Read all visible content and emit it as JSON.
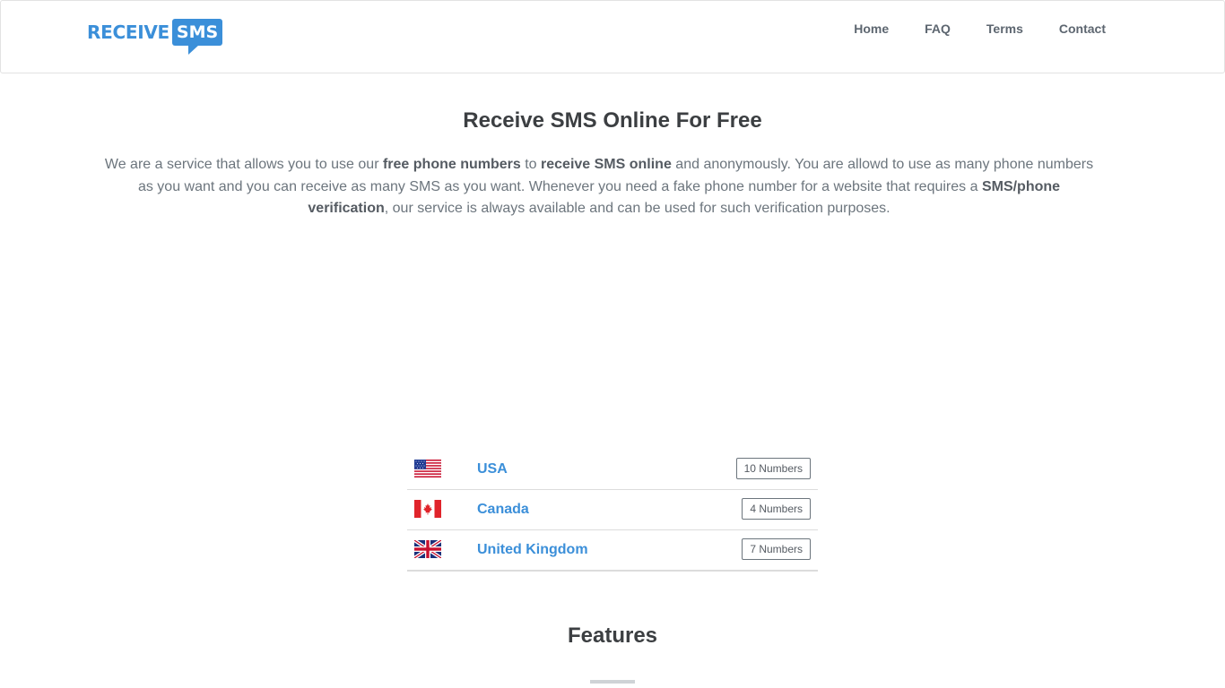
{
  "header": {
    "logo": {
      "word1": "RECEIVE",
      "word2": "SMS",
      "color": "#3b8fd9"
    },
    "nav": [
      {
        "label": "Home"
      },
      {
        "label": "FAQ"
      },
      {
        "label": "Terms"
      },
      {
        "label": "Contact"
      }
    ]
  },
  "hero": {
    "title": "Receive SMS Online For Free",
    "intro": {
      "t1": "We are a service that allows you to use our ",
      "b1": "free phone numbers",
      "t2": " to ",
      "b2": "receive SMS online",
      "t3": " and anonymously. You are allowd to use as many phone numbers as you want and you can receive as many SMS as you want. Whenever you need a fake phone number for a website that requires a ",
      "b3": "SMS/phone verification",
      "t4": ", our service is always available and can be used for such verification purposes."
    }
  },
  "countries": [
    {
      "name": "USA",
      "badge": "10 Numbers",
      "flag_icon": "us-flag-icon"
    },
    {
      "name": "Canada",
      "badge": "4 Numbers",
      "flag_icon": "canada-flag-icon"
    },
    {
      "name": "United Kingdom",
      "badge": "7 Numbers",
      "flag_icon": "uk-flag-icon"
    }
  ],
  "features": {
    "title": "Features"
  }
}
